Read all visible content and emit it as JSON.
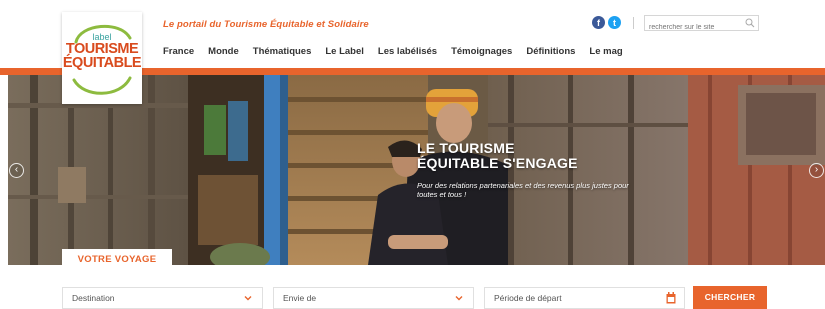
{
  "header": {
    "tagline": "Le portail du Tourisme Équitable et Solidaire",
    "search_placeholder": "rechercher sur le site",
    "social": {
      "facebook": "f",
      "twitter": "t"
    }
  },
  "logo": {
    "small": "label",
    "line1": "TOURISME",
    "line2": "ÉQUITABLE"
  },
  "nav": [
    {
      "label": "France"
    },
    {
      "label": "Monde"
    },
    {
      "label": "Thématiques"
    },
    {
      "label": "Le Label"
    },
    {
      "label": "Les labélisés"
    },
    {
      "label": "Témoignages"
    },
    {
      "label": "Définitions"
    },
    {
      "label": "Le mag"
    }
  ],
  "hero": {
    "title_line1": "LE TOURISME",
    "title_line2": "ÉQUITABLE S'ENGAGE",
    "subtitle": "Pour des relations partenariales et des revenus plus justes pour toutes et tous !",
    "prev": "‹",
    "next": "›"
  },
  "voyage": {
    "tab_label": "VOTRE VOYAGE",
    "destination": "Destination",
    "envie": "Envie de",
    "periode": "Période de départ",
    "submit": "CHERCHER"
  },
  "colors": {
    "accent": "#e8642c",
    "logo_teal": "#3aa3a0",
    "logo_green": "#8dbb3f",
    "text": "#333333"
  },
  "icons": [
    "facebook-icon",
    "twitter-icon",
    "search-icon",
    "chevron-down-icon",
    "calendar-icon",
    "arrow-left-icon",
    "arrow-right-icon"
  ]
}
